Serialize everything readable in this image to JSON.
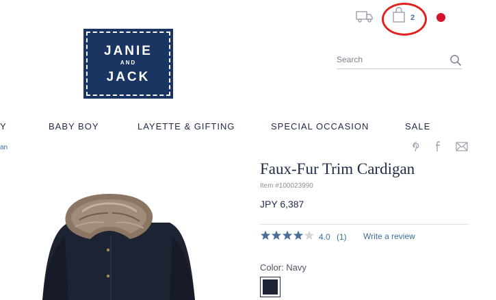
{
  "header": {
    "cart_count": "2",
    "logo": {
      "line1": "JANIE",
      "line2": "AND",
      "line3": "JACK"
    },
    "icons": [
      "truck-icon",
      "shopping-bag-icon",
      "search-icon"
    ],
    "annotation_color": "#e2211c",
    "notification_dot_color": "#d3122c"
  },
  "search": {
    "placeholder": "Search"
  },
  "nav": {
    "items": [
      {
        "label": "Y"
      },
      {
        "label": "BABY BOY"
      },
      {
        "label": "LAYETTE & GIFTING"
      },
      {
        "label": "SPECIAL OCCASION"
      },
      {
        "label": "SALE"
      }
    ]
  },
  "breadcrumb": {
    "fragment": "an"
  },
  "social": {
    "icons": [
      "pinterest-icon",
      "facebook-icon",
      "email-icon"
    ]
  },
  "product": {
    "title": "Faux-Fur Trim Cardigan",
    "item_number": "Item #100023990",
    "price": "JPY 6,387",
    "rating": "4.0",
    "rating_value": 4.0,
    "rating_max": 5,
    "review_count": "(1)",
    "write_review": "Write a review",
    "color_label": "Color: Navy",
    "swatch_color": "#1f2536"
  },
  "colors": {
    "brand_navy": "#1b3563",
    "text": "#1c2a48",
    "link": "#3a6ea5",
    "star": "#4a6f96"
  }
}
